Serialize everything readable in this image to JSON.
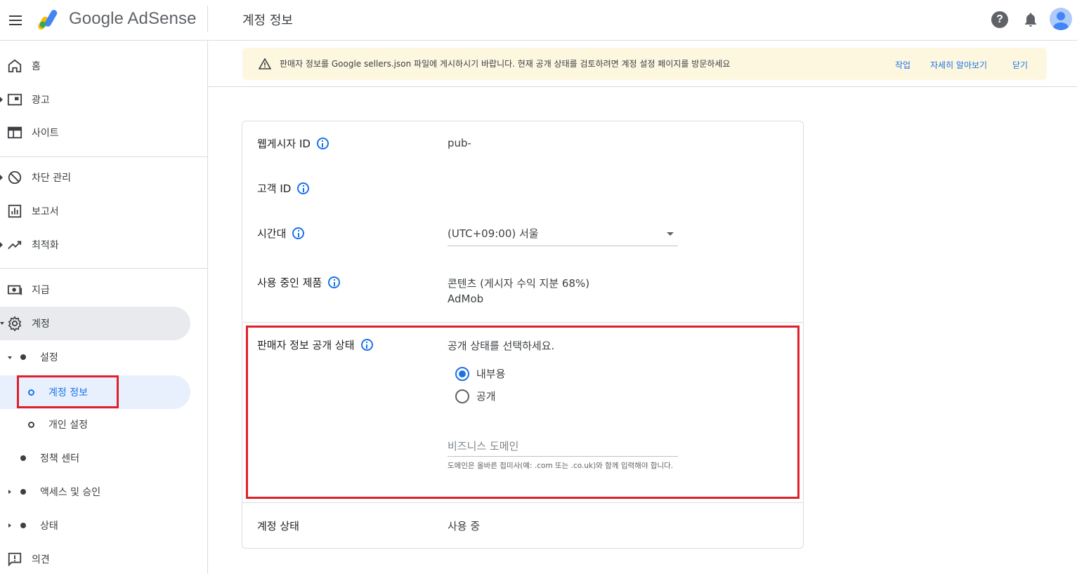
{
  "header": {
    "brand": "Google AdSense",
    "page_title": "계정 정보",
    "icons": [
      "menu-icon",
      "adsense-logo-icon",
      "help-icon",
      "bell-icon",
      "avatar"
    ]
  },
  "sidebar": {
    "items": [
      {
        "label": "홈",
        "icon": "home-icon"
      },
      {
        "label": "광고",
        "icon": "ads-icon"
      },
      {
        "label": "사이트",
        "icon": "sites-icon"
      },
      {
        "label": "차단 관리",
        "icon": "block-icon"
      },
      {
        "label": "보고서",
        "icon": "report-icon"
      },
      {
        "label": "최적화",
        "icon": "trending-icon"
      },
      {
        "label": "지급",
        "icon": "payments-icon"
      },
      {
        "label": "계정",
        "icon": "gear-icon"
      }
    ],
    "sub": {
      "settings": "설정",
      "account_info": "계정 정보",
      "personal_settings": "개인 설정",
      "policy_center": "정책 센터",
      "access_auth": "액세스 및 승인",
      "status": "상태"
    },
    "feedback": "의견"
  },
  "banner": {
    "message": "판매자 정보를 Google sellers.json 파일에 게시하시기 바랍니다. 현재 공개 상태를 검토하려면 계정 설정 페이지를 방문하세요",
    "actions": [
      "작업",
      "자세히 알아보기",
      "닫기"
    ],
    "color": "#fef7e0"
  },
  "card": {
    "publisher_id_label": "웹게시자 ID",
    "publisher_id_value": "pub-",
    "customer_id_label": "고객 ID",
    "timezone_label": "시간대",
    "timezone_value": "(UTC+09:00) 서울",
    "products_label": "사용 중인 제품",
    "products": [
      "콘텐츠 (게시자 수익 지분 68%)",
      "AdMob"
    ],
    "seller_visibility_label": "판매자 정보 공개 상태",
    "visibility_prompt": "공개 상태를 선택하세요.",
    "visibility_options": [
      {
        "label": "내부용",
        "checked": true
      },
      {
        "label": "공개",
        "checked": false
      }
    ],
    "business_domain_placeholder": "비즈니스 도메인",
    "business_domain_hint": "도메인은 올바른 접미사(예: .com 또는 .co.uk)와 함께 입력해야 합니다.",
    "account_status_label": "계정 상태",
    "account_status_value": "사용 중"
  },
  "colors": {
    "accent": "#1a73e8",
    "highlight_box": "#e0202a"
  }
}
